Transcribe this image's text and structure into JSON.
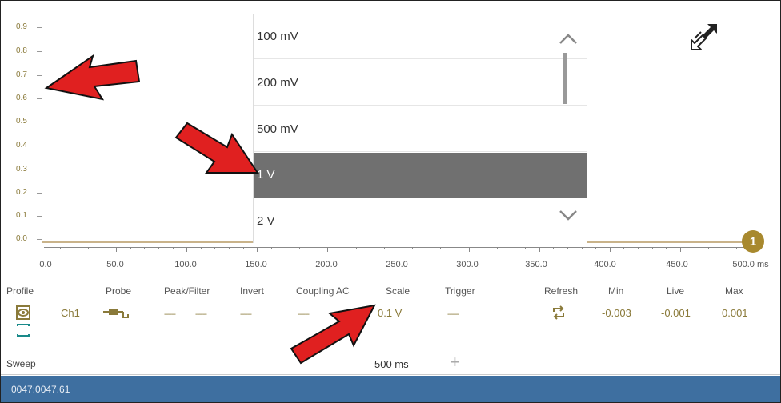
{
  "graph": {
    "y_labels": [
      "0.9",
      "0.8",
      "0.7",
      "0.6",
      "0.5",
      "0.4",
      "0.3",
      "0.2",
      "0.1",
      "0.0"
    ],
    "x_labels": [
      "0.0",
      "50.0",
      "100.0",
      "150.0",
      "200.0",
      "250.0",
      "300.0",
      "350.0",
      "400.0",
      "450.0",
      "500.0 ms"
    ],
    "channel_marker": "1",
    "trace_color": "#c9b38a"
  },
  "scale_dropdown": {
    "options": [
      "100 mV",
      "200 mV",
      "500 mV",
      "1 V",
      "2 V"
    ],
    "selected": "1 V"
  },
  "controls": {
    "headers": {
      "profile": "Profile",
      "probe": "Probe",
      "peak_filter": "Peak/Filter",
      "invert": "Invert",
      "coupling": "Coupling AC",
      "scale": "Scale",
      "trigger": "Trigger",
      "refresh": "Refresh",
      "min": "Min",
      "live": "Live",
      "max": "Max"
    },
    "channel": "Ch1",
    "peak_filter_values": [
      "------",
      "------"
    ],
    "invert_value": "------",
    "coupling_value": "------",
    "scale_value": "0.1 V",
    "trigger_value": "------",
    "min_value": "-0.003",
    "live_value": "-0.001",
    "max_value": "0.001"
  },
  "sweep": {
    "label": "Sweep",
    "value": "500 ms",
    "add_symbol": "+"
  },
  "status_bar": {
    "text": "0047:0047.61"
  },
  "colors": {
    "accent": "#a8892e",
    "status_bar": "#3e6fa0",
    "arrow": "#e02020"
  }
}
